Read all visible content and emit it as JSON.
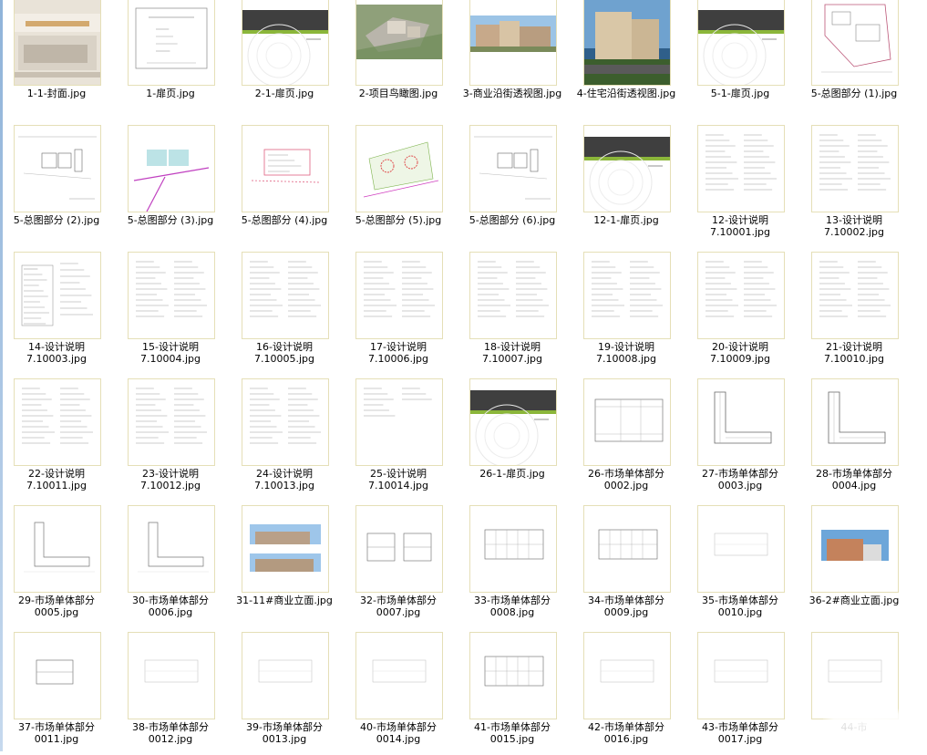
{
  "files": [
    {
      "line1": "1-1-封面.jpg",
      "line2": "",
      "kind": "cover"
    },
    {
      "line1": "1-扉页.jpg",
      "line2": "",
      "kind": "textpage"
    },
    {
      "line1": "2-1-扉页.jpg",
      "line2": "",
      "kind": "divider"
    },
    {
      "line1": "2-项目鸟瞰图.jpg",
      "line2": "",
      "kind": "aerial"
    },
    {
      "line1": "3-商业沿街透视图.jpg",
      "line2": "",
      "kind": "street"
    },
    {
      "line1": "4-住宅沿街透视图.jpg",
      "line2": "",
      "kind": "residential"
    },
    {
      "line1": "5-1-扉页.jpg",
      "line2": "",
      "kind": "divider"
    },
    {
      "line1": "5-总图部分 (1).jpg",
      "line2": "",
      "kind": "siteplan"
    },
    {
      "line1": "5-总图部分 (2).jpg",
      "line2": "",
      "kind": "siteplan-a"
    },
    {
      "line1": "5-总图部分 (3).jpg",
      "line2": "",
      "kind": "siteplan-c"
    },
    {
      "line1": "5-总图部分 (4).jpg",
      "line2": "",
      "kind": "siteplan-p"
    },
    {
      "line1": "5-总图部分 (5).jpg",
      "line2": "",
      "kind": "siteplan-g"
    },
    {
      "line1": "5-总图部分 (6).jpg",
      "line2": "",
      "kind": "siteplan-b"
    },
    {
      "line1": "12-1-扉页.jpg",
      "line2": "",
      "kind": "divider"
    },
    {
      "line1": "12-设计说明",
      "line2": "7.10001.jpg",
      "kind": "text"
    },
    {
      "line1": "13-设计说明",
      "line2": "7.10002.jpg",
      "kind": "text"
    },
    {
      "line1": "14-设计说明",
      "line2": "7.10003.jpg",
      "kind": "table"
    },
    {
      "line1": "15-设计说明",
      "line2": "7.10004.jpg",
      "kind": "text"
    },
    {
      "line1": "16-设计说明",
      "line2": "7.10005.jpg",
      "kind": "text"
    },
    {
      "line1": "17-设计说明",
      "line2": "7.10006.jpg",
      "kind": "text"
    },
    {
      "line1": "18-设计说明",
      "line2": "7.10007.jpg",
      "kind": "text"
    },
    {
      "line1": "19-设计说明",
      "line2": "7.10008.jpg",
      "kind": "text"
    },
    {
      "line1": "20-设计说明",
      "line2": "7.10009.jpg",
      "kind": "text"
    },
    {
      "line1": "21-设计说明",
      "line2": "7.10010.jpg",
      "kind": "text"
    },
    {
      "line1": "22-设计说明",
      "line2": "7.10011.jpg",
      "kind": "text"
    },
    {
      "line1": "23-设计说明",
      "line2": "7.10012.jpg",
      "kind": "text"
    },
    {
      "line1": "24-设计说明",
      "line2": "7.10013.jpg",
      "kind": "text"
    },
    {
      "line1": "25-设计说明",
      "line2": "7.10014.jpg",
      "kind": "textshort"
    },
    {
      "line1": "26-1-扉页.jpg",
      "line2": "",
      "kind": "divider"
    },
    {
      "line1": "26-市场单体部分",
      "line2": "0002.jpg",
      "kind": "floorplan"
    },
    {
      "line1": "27-市场单体部分",
      "line2": "0003.jpg",
      "kind": "lplan"
    },
    {
      "line1": "28-市场单体部分",
      "line2": "0004.jpg",
      "kind": "lplan"
    },
    {
      "line1": "29-市场单体部分",
      "line2": "0005.jpg",
      "kind": "lplan2"
    },
    {
      "line1": "30-市场单体部分",
      "line2": "0006.jpg",
      "kind": "lplan2"
    },
    {
      "line1": "31-11#商业立面.jpg",
      "line2": "",
      "kind": "elevation2"
    },
    {
      "line1": "32-市场单体部分",
      "line2": "0007.jpg",
      "kind": "section"
    },
    {
      "line1": "33-市场单体部分",
      "line2": "0008.jpg",
      "kind": "plan-grid"
    },
    {
      "line1": "34-市场单体部分",
      "line2": "0009.jpg",
      "kind": "plan-grid"
    },
    {
      "line1": "35-市场单体部分",
      "line2": "0010.jpg",
      "kind": "plan-light"
    },
    {
      "line1": "36-2#商业立面.jpg",
      "line2": "",
      "kind": "elevation1"
    },
    {
      "line1": "37-市场单体部分",
      "line2": "0011.jpg",
      "kind": "section-small"
    },
    {
      "line1": "38-市场单体部分",
      "line2": "0012.jpg",
      "kind": "plan-light"
    },
    {
      "line1": "39-市场单体部分",
      "line2": "0013.jpg",
      "kind": "plan-light"
    },
    {
      "line1": "40-市场单体部分",
      "line2": "0014.jpg",
      "kind": "plan-light"
    },
    {
      "line1": "41-市场单体部分",
      "line2": "0015.jpg",
      "kind": "plan-grid"
    },
    {
      "line1": "42-市场单体部分",
      "line2": "0016.jpg",
      "kind": "plan-light"
    },
    {
      "line1": "43-市场单体部分",
      "line2": "0017.jpg",
      "kind": "plan-light"
    },
    {
      "line1": "44-市",
      "line2": "",
      "kind": "plan-light"
    }
  ]
}
